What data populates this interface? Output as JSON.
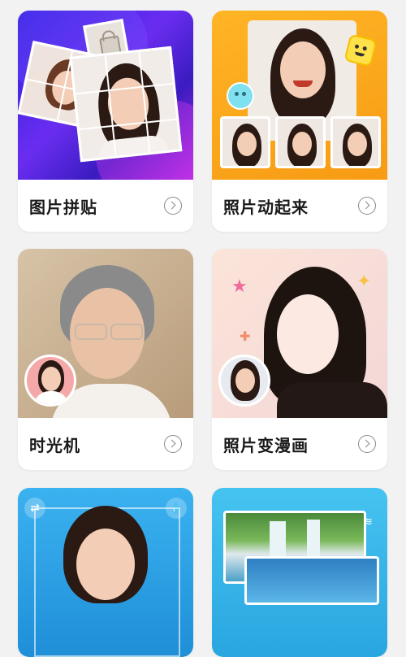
{
  "cards": [
    {
      "label": "图片拼贴",
      "thumb_icon": "collage-photo-thumbnail"
    },
    {
      "label": "照片动起来",
      "thumb_icon": "animated-photo-thumbnail"
    },
    {
      "label": "时光机",
      "thumb_icon": "time-machine-aging-thumbnail"
    },
    {
      "label": "照片变漫画",
      "thumb_icon": "photo-to-comic-thumbnail"
    },
    {
      "label": "",
      "thumb_icon": "portrait-edit-thumbnail"
    },
    {
      "label": "",
      "thumb_icon": "landscape-waterfall-thumbnail"
    }
  ],
  "colors": {
    "page_bg": "#f2f2f2",
    "card_bg": "#ffffff",
    "collage_bg": "#4b2bd9",
    "animate_bg": "#f7a820",
    "time_bg": "#c9b395",
    "comic_bg": "#f6ddd3",
    "portrait_bg": "#2ea3e8",
    "landscape_bg": "#35b7e8"
  }
}
